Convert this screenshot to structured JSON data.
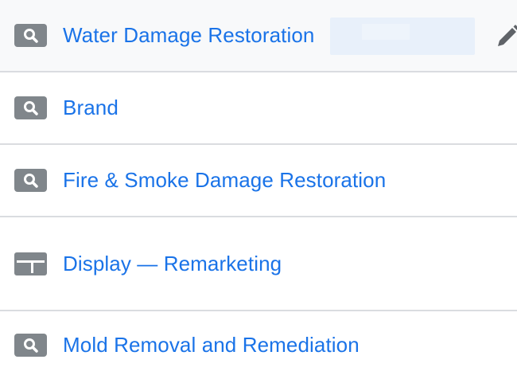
{
  "rows": [
    {
      "label": "Water Damage Restoration",
      "icon": "search-icon",
      "selected": true
    },
    {
      "label": "Brand",
      "icon": "search-icon"
    },
    {
      "label": "Fire & Smoke Damage Restoration",
      "icon": "search-icon"
    },
    {
      "label": "Display — Remarketing",
      "icon": "display-icon"
    },
    {
      "label": "Mold Removal and Remediation",
      "icon": "search-icon"
    }
  ],
  "colors": {
    "link": "#1a73e8",
    "icon": "#80868b",
    "divider": "#dadce0",
    "selected_bg": "#f8f9fa"
  }
}
